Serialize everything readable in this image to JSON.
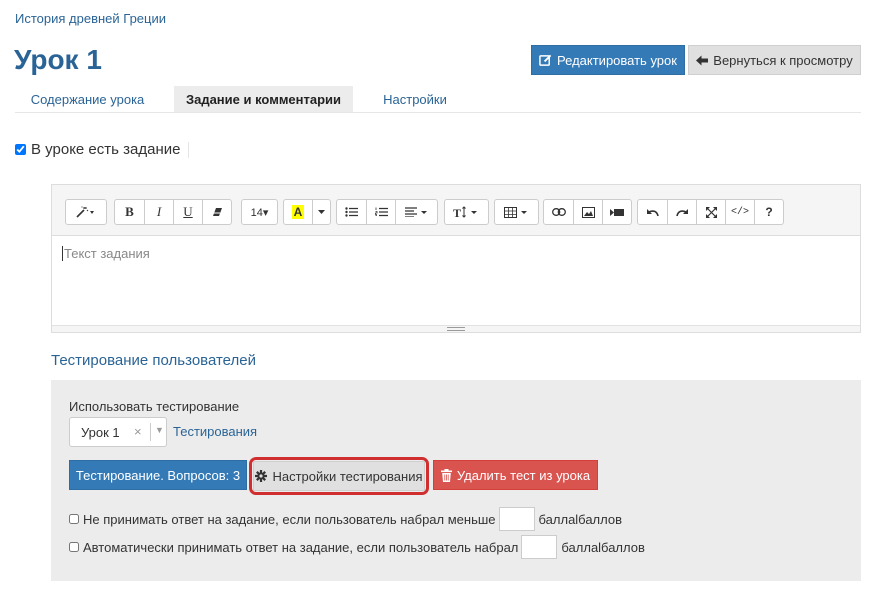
{
  "breadcrumb": "История древней Греции",
  "page_title": "Урок 1",
  "header_buttons": {
    "edit_label": "Редактировать урок",
    "back_label": "Вернуться к просмотру"
  },
  "tabs": [
    {
      "label": "Содержание урока",
      "active": false
    },
    {
      "label": "Задание и комментарии",
      "active": true
    },
    {
      "label": "Настройки",
      "active": false
    }
  ],
  "has_task_checkbox": {
    "label": "В уроке есть задание",
    "checked": true
  },
  "editor": {
    "placeholder": "Текст задания",
    "toolbar": {
      "bold": "B",
      "italic": "I",
      "underline": "U",
      "font_size": "14▾",
      "highlight_letter": "A",
      "help": "?",
      "code": "</>"
    }
  },
  "testing": {
    "section_title": "Тестирование пользователей",
    "use_label": "Использовать тестирование",
    "selected_test": "Урок 1",
    "clear_symbol": "×",
    "link_label": "Тестирования",
    "questions_button": "Тестирование. Вопросов: 3",
    "settings_button": "Настройки тестирования",
    "delete_button": "Удалить тест из урока",
    "option1_label": "Не принимать ответ на задание, если пользователь набрал меньше",
    "option1_suffix": "баллаlбаллов",
    "option1_checked": false,
    "option2_label": "Автоматически принимать ответ на задание, если пользователь набрал",
    "option2_suffix": "баллаlбаллов",
    "option2_checked": false
  },
  "colors": {
    "primary": "#337ab7",
    "danger": "#d9534f",
    "link": "#2a6496",
    "highlight_border": "#d12f2f",
    "panel_bg": "#ececec"
  }
}
